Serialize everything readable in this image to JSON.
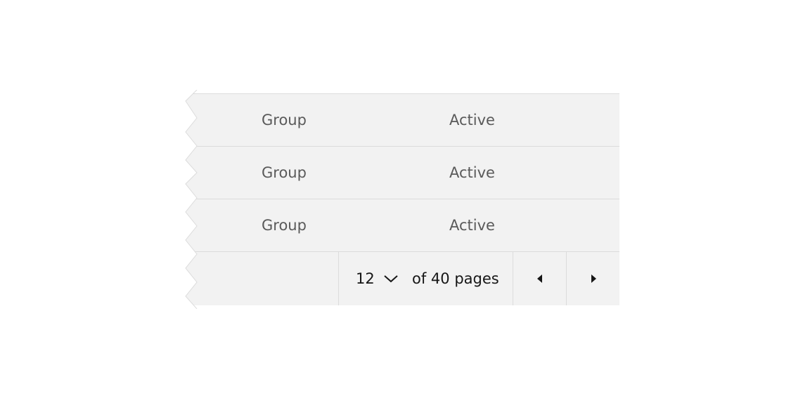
{
  "table": {
    "rows": [
      {
        "group": "Group",
        "status": "Active"
      },
      {
        "group": "Group",
        "status": "Active"
      },
      {
        "group": "Group",
        "status": "Active"
      }
    ]
  },
  "pagination": {
    "page_value": "12",
    "of_pages_text": "of 40 pages",
    "prev_icon": "caret-left-icon",
    "next_icon": "caret-right-icon",
    "select_icon": "chevron-down-icon"
  },
  "colors": {
    "table_bg": "#f2f2f2",
    "divider": "#dcdcdc",
    "text_primary": "#161616",
    "text_secondary": "#5a5a5a"
  }
}
